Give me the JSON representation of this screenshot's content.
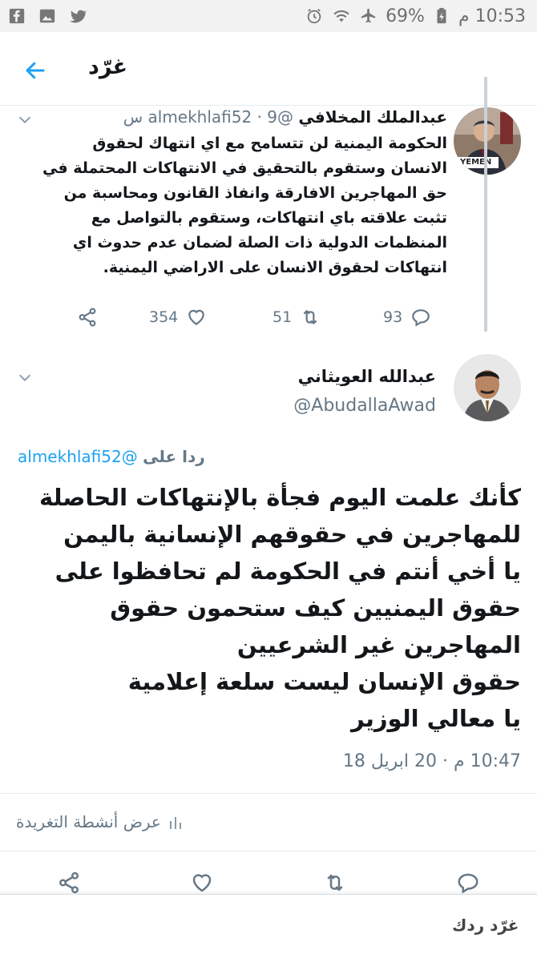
{
  "status_bar": {
    "time": "10:53 م",
    "battery": "69%"
  },
  "header": {
    "title": "غرّد"
  },
  "parent_tweet": {
    "name": "عبدالملك المخلافي",
    "handle": "@almekhlafi52",
    "time": "· 9 س",
    "avatar_caption": "YEMEN",
    "lines": [
      "الحكومة اليمنية لن تتسامح مع اي انتهاك لحقوق",
      "الانسان وستقوم  بالتحقيق في الانتهاكات المحتملة في",
      "حق المهاجرين الافارقة وانفاذ القانون ومحاسبة من",
      "تثبت علاقته باي انتهاكات، وستقوم بالتواصل مع",
      "المنظمات الدولية ذات الصلة لضمان عدم حدوث اي",
      "انتهاكات لحقوق الانسان على الاراضي اليمنية."
    ],
    "stats": {
      "replies": "93",
      "retweets": "51",
      "likes": "354"
    }
  },
  "main_tweet": {
    "name": "عبدالله العويثاني",
    "handle": "@AbudallaAwad",
    "reply_label": "ردا على",
    "reply_mention": "@almekhlafi52",
    "lines": [
      "كأنك علمت اليوم فجأة بالإنتهاكات الحاصلة",
      "للمهاجرين في حقوقهم الإنسانية باليمن",
      "يا أخي أنتم في الحكومة لم تحافظوا على",
      "حقوق اليمنيين كيف ستحمون حقوق",
      "المهاجرين غير الشرعيين",
      "حقوق الإنسان ليست سلعة إعلامية",
      "يا معالي الوزير"
    ],
    "timestamp": "10:47 م · 20 ابريل 18",
    "activity_label": "عرض أنشطة التغريدة"
  },
  "reply_box": {
    "placeholder": "غرّد ردك"
  },
  "icons": {
    "back": "arrow-left-icon",
    "reply": "reply-bubble-icon",
    "retweet": "retweet-icon",
    "like": "heart-icon",
    "share": "share-icon",
    "chevron": "chevron-down-icon"
  },
  "colors": {
    "accent": "#1da1f2",
    "muted": "#657786",
    "text": "#14171a"
  }
}
